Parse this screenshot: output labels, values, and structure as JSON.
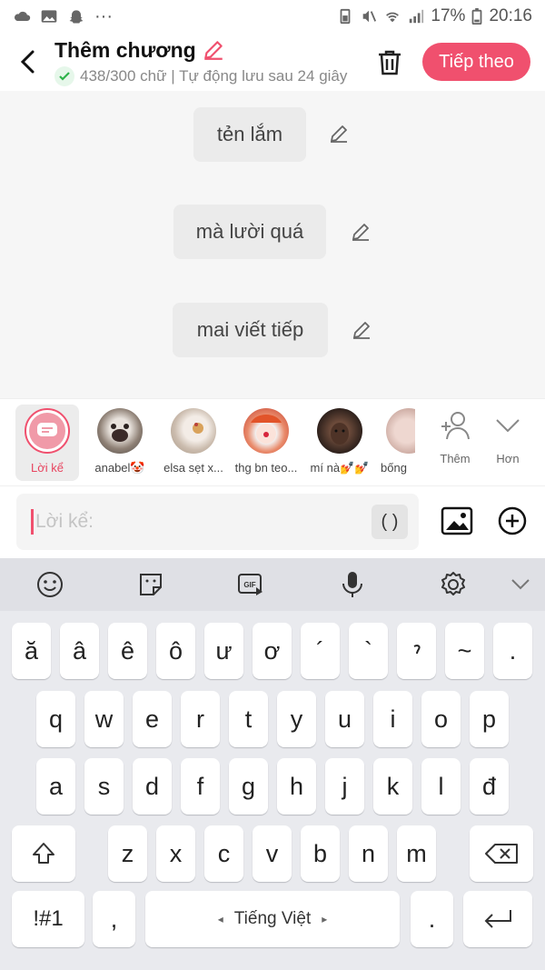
{
  "status_bar": {
    "battery": "17%",
    "time": "20:16"
  },
  "header": {
    "title": "Thêm chương",
    "subtitle": "438/300 chữ | Tự động lưu sau 24 giây",
    "next_label": "Tiếp theo"
  },
  "messages": [
    {
      "text": "tẻn lắm"
    },
    {
      "text": "mà lười quá"
    },
    {
      "text": "mai viết tiếp"
    }
  ],
  "characters": [
    {
      "name": "Lời kể",
      "selected": true
    },
    {
      "name": "anabel🤡"
    },
    {
      "name": "elsa sẹt x..."
    },
    {
      "name": "thg bn teo..."
    },
    {
      "name": "mí nà💅💅"
    },
    {
      "name": "bống"
    }
  ],
  "actions": {
    "add_label": "Thêm",
    "more_label": "Hơn"
  },
  "composer": {
    "placeholder": "Lời kể:",
    "paren_label": "( )"
  },
  "keyboard": {
    "row1": [
      "ă",
      "â",
      "ê",
      "ô",
      "ư",
      "ơ",
      "´",
      "`",
      "̉",
      "~",
      "."
    ],
    "row2": [
      "q",
      "w",
      "e",
      "r",
      "t",
      "y",
      "u",
      "i",
      "o",
      "p"
    ],
    "row3": [
      "a",
      "s",
      "d",
      "f",
      "g",
      "h",
      "j",
      "k",
      "l",
      "đ"
    ],
    "row4": [
      "z",
      "x",
      "c",
      "v",
      "b",
      "n",
      "m"
    ],
    "symbols_label": "!#1",
    "comma_label": ",",
    "space_label": "Tiếng Việt",
    "period_label": ".",
    "space_left_arrow": "◂",
    "space_right_arrow": "▸"
  },
  "colors": {
    "accent": "#f0506e",
    "keyboard_bg": "#e9eaee"
  }
}
